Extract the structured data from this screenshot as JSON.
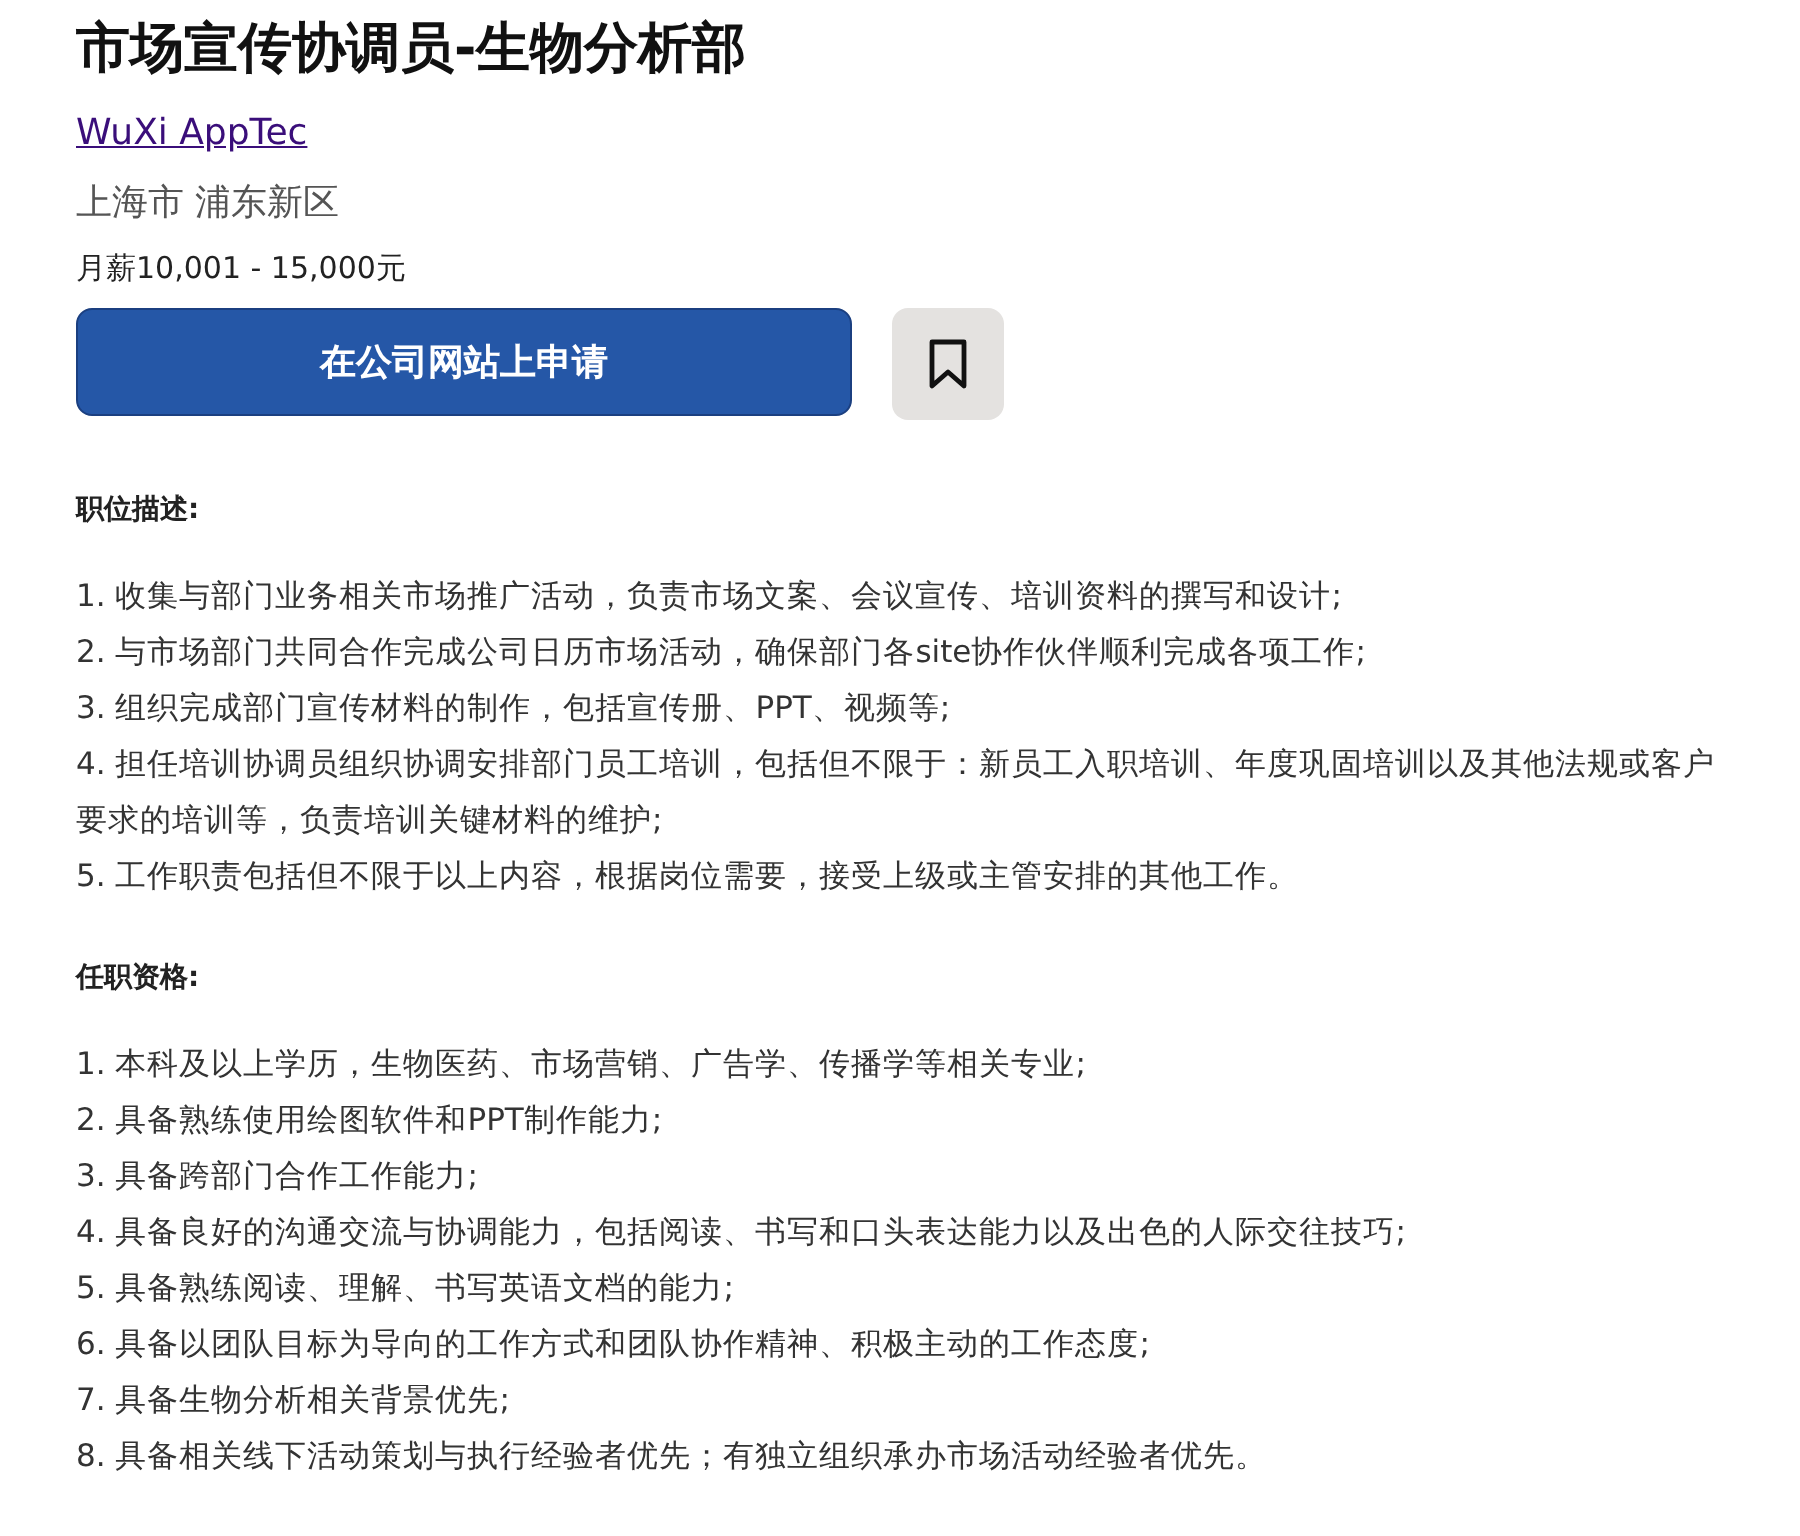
{
  "job_title": "市场宣传协调员-生物分析部",
  "company_link": "WuXi AppTec",
  "location": "上海市 浦东新区",
  "salary": "月薪10,001 - 15,000元",
  "apply_button": "在公司网站上申请",
  "bookmark": {
    "saved": false
  },
  "sections": [
    {
      "heading": "职位描述:",
      "items": [
        "1. 收集与部门业务相关市场推广活动，负责市场文案、会议宣传、培训资料的撰写和设计;",
        "2. 与市场部门共同合作完成公司日历市场活动，确保部门各site协作伙伴顺利完成各项工作;",
        "3. 组织完成部门宣传材料的制作，包括宣传册、PPT、视频等;",
        "4. 担任培训协调员组织协调安排部门员工培训，包括但不限于：新员工入职培训、年度巩固培训以及其他法规或客户要求的培训等，负责培训关键材料的维护;",
        "5. 工作职责包括但不限于以上内容，根据岗位需要，接受上级或主管安排的其他工作。"
      ]
    },
    {
      "heading": "任职资格:",
      "items": [
        "1. 本科及以上学历，生物医药、市场营销、广告学、传播学等相关专业;",
        "2. 具备熟练使用绘图软件和PPT制作能力;",
        "3. 具备跨部门合作工作能力;",
        "4. 具备良好的沟通交流与协调能力，包括阅读、书写和口头表达能力以及出色的人际交往技巧;",
        "5. 具备熟练阅读、理解、书写英语文档的能力;",
        "6. 具备以团队目标为导向的工作方式和团队协作精神、积极主动的工作态度;",
        "7. 具备生物分析相关背景优先;",
        "8. 具备相关线下活动策划与执行经验者优先；有独立组织承办市场活动经验者优先。"
      ]
    }
  ]
}
